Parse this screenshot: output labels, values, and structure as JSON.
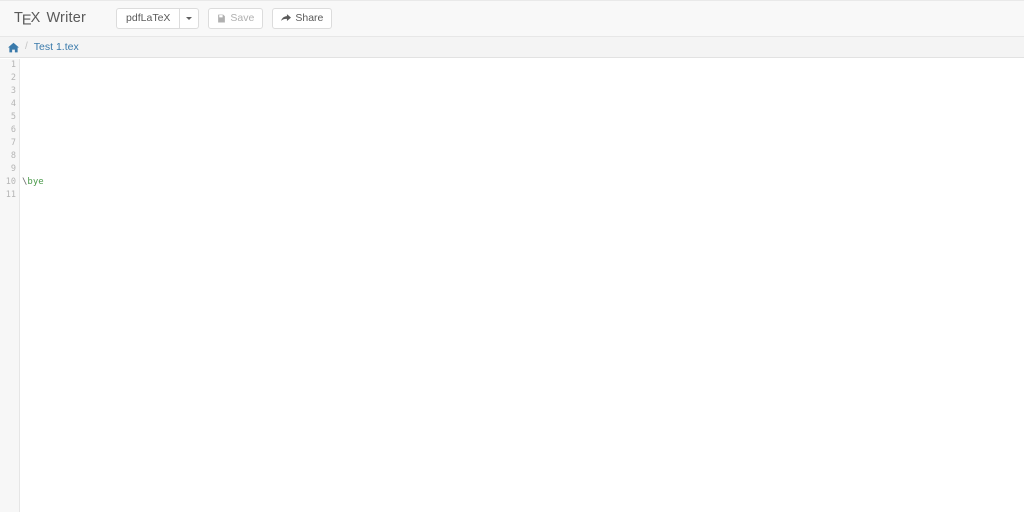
{
  "app": {
    "brand_pre": "T",
    "brand_e": "E",
    "brand_post": "X",
    "brand_suffix": "Writer"
  },
  "toolbar": {
    "engine_label": "pdfLaTeX",
    "engine_caret_icon": "chevron-down-icon",
    "save_label": "Save",
    "save_icon": "floppy-disk-icon",
    "save_disabled": true,
    "share_label": "Share",
    "share_icon": "share-arrow-icon"
  },
  "breadcrumb": {
    "home_icon": "home-icon",
    "separator": "/",
    "file_label": "Test 1.tex"
  },
  "editor": {
    "line_numbers": [
      "1",
      "2",
      "3",
      "4",
      "5",
      "6",
      "7",
      "8",
      "9",
      "10",
      "11"
    ],
    "lines": [
      {
        "n": "1",
        "backslash": "",
        "command": "",
        "rest": ""
      },
      {
        "n": "2",
        "backslash": "",
        "command": "",
        "rest": ""
      },
      {
        "n": "3",
        "backslash": "",
        "command": "",
        "rest": ""
      },
      {
        "n": "4",
        "backslash": "",
        "command": "",
        "rest": ""
      },
      {
        "n": "5",
        "backslash": "",
        "command": "",
        "rest": ""
      },
      {
        "n": "6",
        "backslash": "",
        "command": "",
        "rest": ""
      },
      {
        "n": "7",
        "backslash": "",
        "command": "",
        "rest": ""
      },
      {
        "n": "8",
        "backslash": "",
        "command": "",
        "rest": ""
      },
      {
        "n": "9",
        "backslash": "",
        "command": "",
        "rest": ""
      },
      {
        "n": "10",
        "backslash": "\\",
        "command": "bye",
        "rest": ""
      },
      {
        "n": "11",
        "backslash": "",
        "command": "",
        "rest": ""
      }
    ]
  },
  "colors": {
    "link": "#3a7aab",
    "command_token": "#4a9a4a",
    "navbar_bg": "#f8f8f8",
    "breadcrumb_bg": "#f4f4f4",
    "gutter_bg": "#f7f7f7"
  }
}
